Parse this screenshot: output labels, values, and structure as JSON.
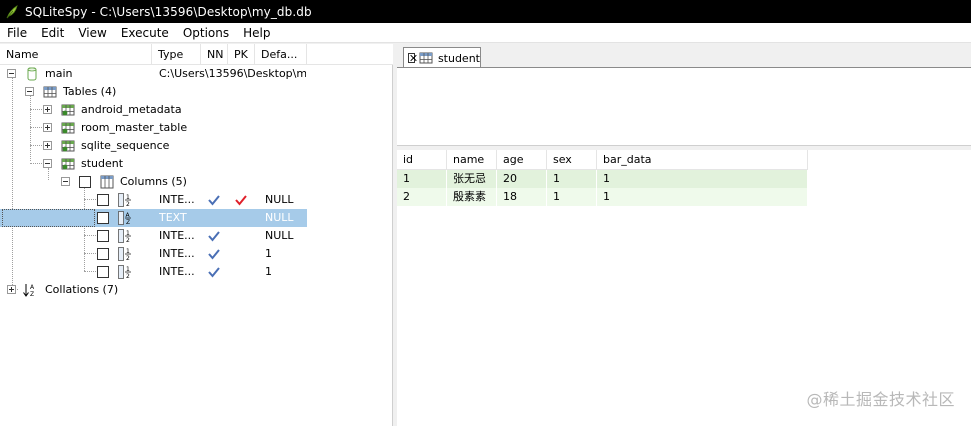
{
  "window": {
    "title": "SQLiteSpy - C:\\Users\\13596\\Desktop\\my_db.db",
    "app_icon": "feather-icon"
  },
  "menu": {
    "items": [
      "File",
      "Edit",
      "View",
      "Execute",
      "Options",
      "Help"
    ]
  },
  "tree": {
    "columns": {
      "name": "Name",
      "type": "Type",
      "nn": "NN",
      "pk": "PK",
      "default": "Defa..."
    },
    "main": {
      "label": "main",
      "path": "C:\\Users\\13596\\Desktop\\m..."
    },
    "tables": {
      "label": "Tables (4)"
    },
    "table_list": [
      {
        "label": "android_metadata"
      },
      {
        "label": "room_master_table"
      },
      {
        "label": "sqlite_sequence"
      },
      {
        "label": "student"
      }
    ],
    "columns_node": {
      "label": "Columns (5)"
    },
    "column_rows": [
      {
        "type": "INTE...",
        "nn": true,
        "pk": true,
        "default": "NULL",
        "selected": false
      },
      {
        "type": "TEXT",
        "nn": false,
        "pk": false,
        "default": "NULL",
        "selected": true
      },
      {
        "type": "INTE...",
        "nn": true,
        "pk": false,
        "default": "NULL",
        "selected": false
      },
      {
        "type": "INTE...",
        "nn": true,
        "pk": false,
        "default": "1",
        "selected": false
      },
      {
        "type": "INTE...",
        "nn": true,
        "pk": false,
        "default": "1",
        "selected": false
      }
    ],
    "collations": {
      "label": "Collations (7)"
    },
    "check_color": "#4a6fb5",
    "pk_color": "#e0202a"
  },
  "tab": {
    "label": "student"
  },
  "grid": {
    "headers": [
      "id",
      "name",
      "age",
      "sex",
      "bar_data"
    ],
    "rows": [
      [
        "1",
        "张无忌",
        "20",
        "1",
        "1"
      ],
      [
        "2",
        "殷素素",
        "18",
        "1",
        "1"
      ]
    ]
  },
  "watermark": "@稀土掘金技术社区"
}
